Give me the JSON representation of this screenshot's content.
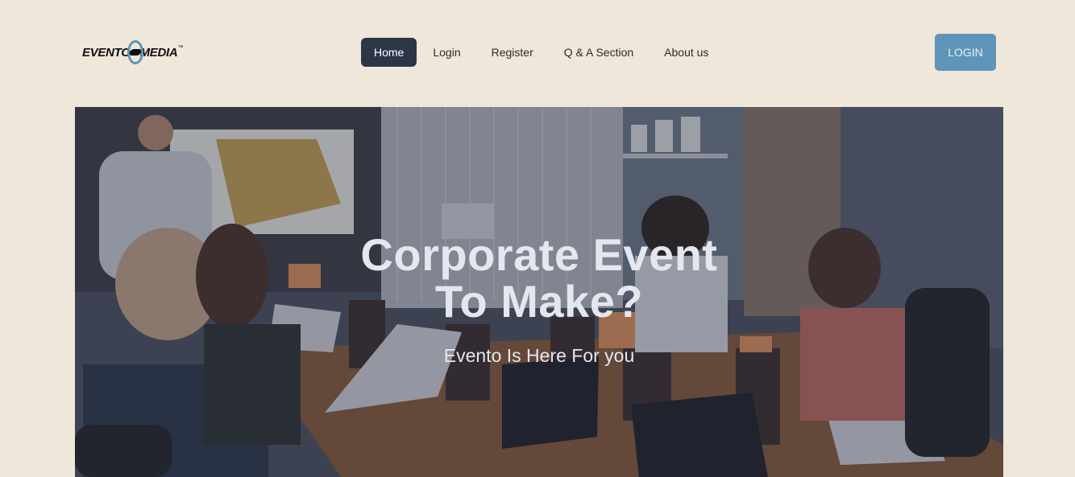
{
  "brand": {
    "logo_left": "EVENTO",
    "logo_right": "MEDIA",
    "trademark": "™",
    "ring_color": "#5f95b8"
  },
  "nav": {
    "items": [
      {
        "label": "Home",
        "active": true
      },
      {
        "label": "Login",
        "active": false
      },
      {
        "label": "Register",
        "active": false
      },
      {
        "label": "Q & A Section",
        "active": false
      },
      {
        "label": "About us",
        "active": false
      }
    ],
    "active_color": "#2d3547"
  },
  "header_button": {
    "label": "LOGIN",
    "color": "#5f95b8"
  },
  "hero": {
    "title_line1": "Corporate Event",
    "title_line2": "To Make?",
    "subtitle": "Evento Is Here For you"
  },
  "colors": {
    "page_background": "#efe7da"
  }
}
